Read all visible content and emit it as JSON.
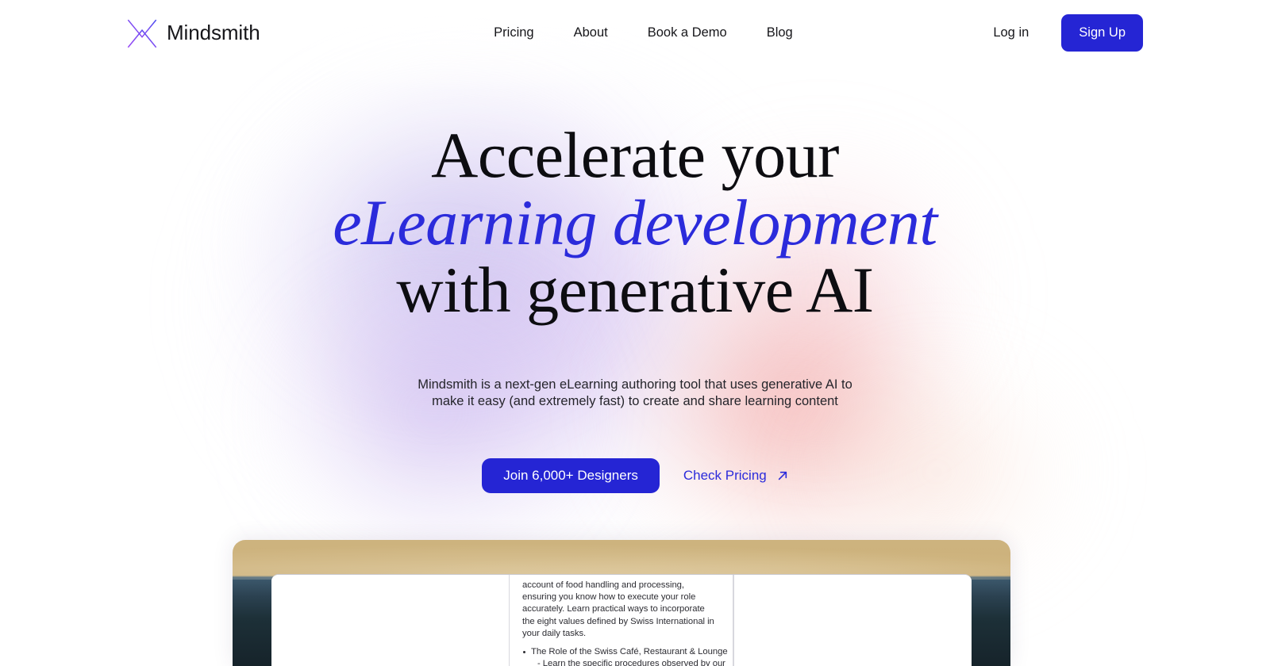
{
  "brand": {
    "name": "Mindsmith",
    "logo_icon": "mindsmith-butterfly-mark",
    "logo_color_start": "#8b4cf0",
    "logo_color_end": "#4c4cf0"
  },
  "header": {
    "nav": [
      {
        "label": "Pricing"
      },
      {
        "label": "About"
      },
      {
        "label": "Book a Demo"
      },
      {
        "label": "Blog"
      }
    ],
    "login_label": "Log in",
    "signup_label": "Sign Up",
    "signup_color": "#2525d4"
  },
  "hero": {
    "headline_line1": "Accelerate your",
    "headline_accent": "eLearning development",
    "headline_line3": "with generative AI",
    "accent_color": "#2b2bdb",
    "sub_line1": "Mindsmith is a next-gen eLearning authoring tool that uses generative AI to",
    "sub_line2": "make it easy (and extremely fast) to create and share learning content",
    "cta_primary_label": "Join 6,000+ Designers",
    "cta_secondary_label": "Check Pricing",
    "cta_secondary_icon": "arrow-up-right-icon"
  },
  "product_shot": {
    "paragraph_lines": [
      "account of food handling and processing,",
      "ensuring you know how to execute your role",
      "accurately. Learn practical ways to incorporate",
      "the eight values defined by Swiss International in",
      "your daily tasks."
    ],
    "bullets": [
      {
        "text": "The Role of the Swiss Café, Restaurant & Lounge",
        "sub": "- Learn the specific procedures observed by our"
      }
    ]
  }
}
